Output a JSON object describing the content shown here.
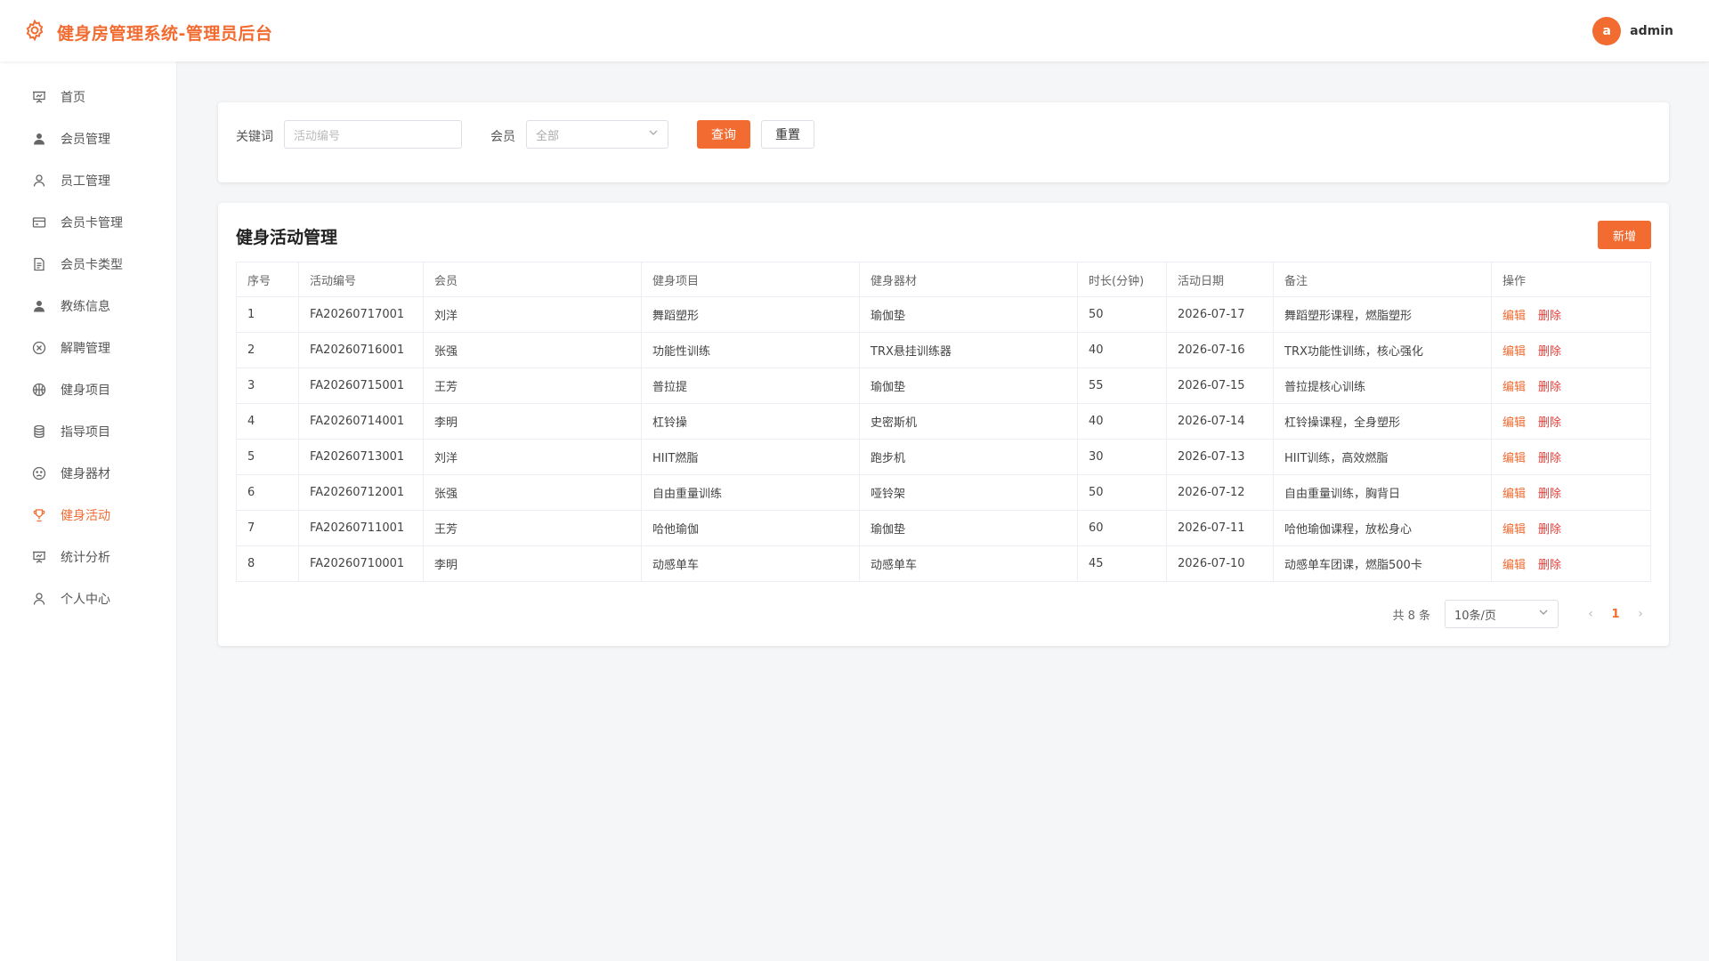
{
  "header": {
    "title": "健身房管理系统-管理员后台",
    "avatar_letter": "a",
    "username": "admin",
    "accent": "#f26b30"
  },
  "sidebar": {
    "items": [
      {
        "label": "首页",
        "icon": "presentation-board-icon"
      },
      {
        "label": "会员管理",
        "icon": "user-solid-icon"
      },
      {
        "label": "员工管理",
        "icon": "user-outline-icon"
      },
      {
        "label": "会员卡管理",
        "icon": "credit-card-icon"
      },
      {
        "label": "会员卡类型",
        "icon": "document-icon"
      },
      {
        "label": "教练信息",
        "icon": "user-solid-icon"
      },
      {
        "label": "解聘管理",
        "icon": "circle-close-icon"
      },
      {
        "label": "健身项目",
        "icon": "basketball-icon"
      },
      {
        "label": "指导项目",
        "icon": "coin-stack-icon"
      },
      {
        "label": "健身器材",
        "icon": "sad-face-icon"
      },
      {
        "label": "健身活动",
        "icon": "trophy-icon"
      },
      {
        "label": "统计分析",
        "icon": "presentation-board-icon"
      },
      {
        "label": "个人中心",
        "icon": "user-outline-icon"
      }
    ],
    "active_index": 10
  },
  "filter": {
    "keyword_label": "关键词",
    "keyword_placeholder": "活动编号",
    "member_label": "会员",
    "member_value": "全部",
    "search_label": "查询",
    "reset_label": "重置"
  },
  "table_card": {
    "title": "健身活动管理",
    "add_label": "新增",
    "columns": [
      "序号",
      "活动编号",
      "会员",
      "健身项目",
      "健身器材",
      "时长(分钟)",
      "活动日期",
      "备注",
      "操作"
    ],
    "rows": [
      [
        "1",
        "FA20260717001",
        "刘洋",
        "舞蹈塑形",
        "瑜伽垫",
        "50",
        "2026-07-17",
        "舞蹈塑形课程，燃脂塑形"
      ],
      [
        "2",
        "FA20260716001",
        "张强",
        "功能性训练",
        "TRX悬挂训练器",
        "40",
        "2026-07-16",
        "TRX功能性训练，核心强化"
      ],
      [
        "3",
        "FA20260715001",
        "王芳",
        "普拉提",
        "瑜伽垫",
        "55",
        "2026-07-15",
        "普拉提核心训练"
      ],
      [
        "4",
        "FA20260714001",
        "李明",
        "杠铃操",
        "史密斯机",
        "40",
        "2026-07-14",
        "杠铃操课程，全身塑形"
      ],
      [
        "5",
        "FA20260713001",
        "刘洋",
        "HIIT燃脂",
        "跑步机",
        "30",
        "2026-07-13",
        "HIIT训练，高效燃脂"
      ],
      [
        "6",
        "FA20260712001",
        "张强",
        "自由重量训练",
        "哑铃架",
        "50",
        "2026-07-12",
        "自由重量训练，胸背日"
      ],
      [
        "7",
        "FA20260711001",
        "王芳",
        "哈他瑜伽",
        "瑜伽垫",
        "60",
        "2026-07-11",
        "哈他瑜伽课程，放松身心"
      ],
      [
        "8",
        "FA20260710001",
        "李明",
        "动感单车",
        "动感单车",
        "45",
        "2026-07-10",
        "动感单车团课，燃脂500卡"
      ]
    ],
    "edit_label": "编辑",
    "delete_label": "删除"
  },
  "pagination": {
    "total_text": "共 8 条",
    "page_size": "10条/页",
    "current_page": "1",
    "prev": "‹",
    "next": "›"
  }
}
